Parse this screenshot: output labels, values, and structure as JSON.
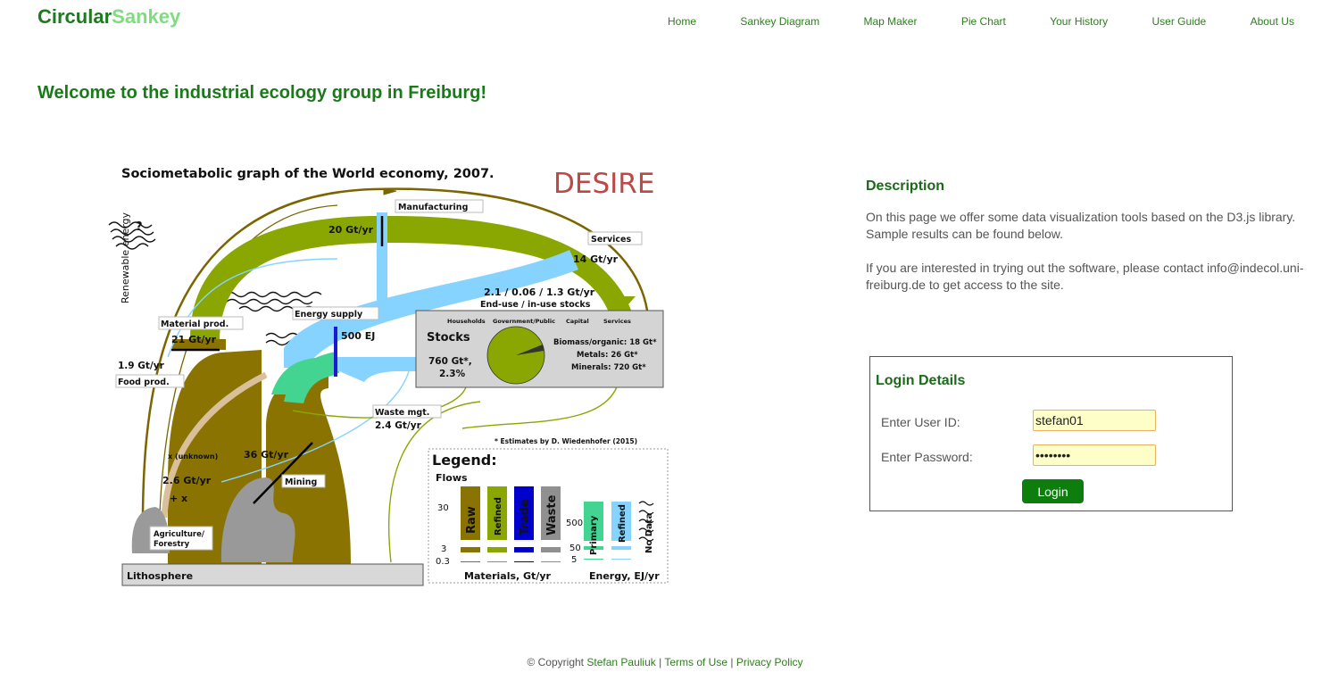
{
  "header": {
    "brand_part1": "Circular",
    "brand_part2": "Sankey",
    "nav": [
      "Home",
      "Sankey Diagram",
      "Map Maker",
      "Pie Chart",
      "Your History",
      "User Guide",
      "About Us"
    ]
  },
  "page_title": "Welcome to the industrial ecology group in Freiburg!",
  "figure": {
    "title": "Sociometabolic graph of the World economy, 2007.",
    "logo": "DESIRE",
    "labels": {
      "renewable_energy": "Renewable energy",
      "question": "?",
      "manufacturing": "Manufacturing",
      "manufacturing_value": "20 Gt/yr",
      "services": "Services",
      "services_value": "14 Gt/yr",
      "end_use_values": "2.1 / 0.06 / 1.3 Gt/yr",
      "end_use_title": "End-use / in-use stocks",
      "material_prod": "Material prod.",
      "material_prod_value": "21 Gt/yr",
      "energy_supply": "Energy supply",
      "energy_supply_value": "500 EJ",
      "food_prod_value": "1.9 Gt/yr",
      "food_prod": "Food prod.",
      "waste_mgt": "Waste mgt.",
      "waste_mgt_value": "2.4 Gt/yr",
      "x_unknown": "x (unknown)",
      "agri_value": "2.6 Gt/yr",
      "agri_value2": "+ x",
      "mining_value": "36 Gt/yr",
      "mining": "Mining",
      "agri_1": "Agriculture/",
      "agri_2": "Forestry",
      "lithosphere": "Lithosphere",
      "estimates": "* Estimates by D. Wiedenhofer (2015)"
    },
    "stocks": {
      "sectors": [
        "Households",
        "Government/Public",
        "Capital",
        "Services"
      ],
      "title": "Stocks",
      "total_1": "760 Gt*,",
      "total_2": "2.3%",
      "biomass": "Biomass/organic: 18 Gt*",
      "metals": "Metals: 26 Gt*",
      "minerals": "Minerals: 720 Gt*"
    },
    "legend": {
      "title": "Legend:",
      "flows": "Flows",
      "material_ticks": [
        "30",
        "3",
        "0.3"
      ],
      "material_types": [
        "Raw",
        "Refined",
        "Trade",
        "Waste"
      ],
      "materials_axis": "Materials, Gt/yr",
      "energy_ticks": [
        "500",
        "50",
        "5"
      ],
      "energy_types": [
        "Primary",
        "Refined",
        "No Data"
      ],
      "energy_axis": "Energy, EJ/yr",
      "colors": {
        "raw": "#8a7300",
        "refined": "#8aa600",
        "trade": "#0000cc",
        "waste": "#909090",
        "primary": "#44d492",
        "energy_refined": "#86d3ff"
      }
    }
  },
  "description": {
    "heading": "Description",
    "para1": "On this page we offer some data visualization tools based on the D3.js library. Sample results can be found below.",
    "para2": "If you are interested in trying out the software, please contact info@indecol.uni-freiburg.de to get access to the site."
  },
  "login": {
    "heading": "Login Details",
    "user_label": "Enter User ID:",
    "user_value": "stefan01",
    "password_label": "Enter Password:",
    "password_value": "••••••••",
    "button": "Login"
  },
  "footer": {
    "copyright": "© Copyright",
    "author": "Stefan Pauliuk",
    "sep": "|",
    "terms": "Terms of Use",
    "privacy": "Privacy Policy"
  }
}
